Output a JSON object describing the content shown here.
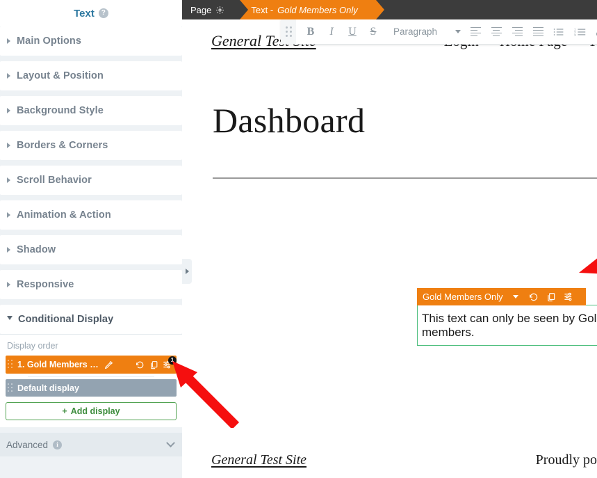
{
  "sidebar": {
    "title": "Text",
    "help_icon": "help-icon",
    "sections": [
      {
        "label": "Main Options",
        "expanded": false
      },
      {
        "label": "Layout & Position",
        "expanded": false
      },
      {
        "label": "Background Style",
        "expanded": false
      },
      {
        "label": "Borders & Corners",
        "expanded": false
      },
      {
        "label": "Scroll Behavior",
        "expanded": false
      },
      {
        "label": "Animation & Action",
        "expanded": false
      },
      {
        "label": "Shadow",
        "expanded": false
      },
      {
        "label": "Responsive",
        "expanded": false
      },
      {
        "label": "Conditional Display",
        "expanded": true
      }
    ],
    "conditional_display": {
      "display_order_label": "Display order",
      "rows": [
        {
          "label": "1. Gold Members …",
          "state": "active",
          "edit_icon": "pencil-icon",
          "icons": [
            "revert-icon",
            "duplicate-icon",
            "settings-sliders-icon"
          ],
          "badge": "1"
        },
        {
          "label": "Default display",
          "state": "default",
          "icons": [],
          "badge": ""
        }
      ],
      "add_display_label": "Add display",
      "add_display_plus": "+"
    },
    "advanced": {
      "label": "Advanced",
      "info_icon": "info-icon",
      "chevron": "chevron-down-icon"
    },
    "collapse_handle": "collapse-panel-handle"
  },
  "topbar": {
    "tabs": [
      {
        "label": "Page",
        "icon": "gear-icon",
        "active": false
      },
      {
        "label": "Text - ",
        "emphasis": "Gold Members Only",
        "active": true
      }
    ]
  },
  "toolbar": {
    "drag_handle": "toolbar-drag-handle",
    "bold": "B",
    "italic": "I",
    "underline": "U",
    "strikethrough": "S",
    "paragraph_select": "Paragraph",
    "align_left": "align-left-icon",
    "align_center": "align-center-icon",
    "align_right": "align-right-icon",
    "align_justify": "align-justify-icon",
    "bullet_list": "bullet-list-icon",
    "numbered_list": "numbered-list-icon",
    "numbered_list_digits": [
      "1",
      "2",
      "3"
    ],
    "link": "link-icon"
  },
  "page": {
    "site_title": "General Test Site",
    "nav": [
      "Login",
      "Home Page",
      "T"
    ],
    "heading": "Dashboard",
    "footer_title": "General Test Site",
    "footer_right": "Proudly po"
  },
  "text_block": {
    "tag_label": "Gold Members Only",
    "tag_chevron": "chevron-down-icon",
    "tag_icons": [
      "revert-icon",
      "duplicate-icon",
      "settings-sliders-icon"
    ],
    "content": "This text can only be seen by Gold members."
  },
  "annotations": {
    "arrows": [
      {
        "name": "arrow-to-block-settings-icon",
        "color": "#f50f0f"
      },
      {
        "name": "arrow-to-display-row-settings-icon",
        "color": "#f50f0f"
      }
    ]
  },
  "colors": {
    "accent_orange": "#ef7f11",
    "sidebar_bg": "#eef2f5",
    "topbar_bg": "#3c3c3c",
    "block_green": "#4fbf7f",
    "add_green": "#52a352",
    "annotation_red": "#f50f0f",
    "title_blue": "#2e78a0",
    "default_row_grey": "#93a3b1"
  }
}
